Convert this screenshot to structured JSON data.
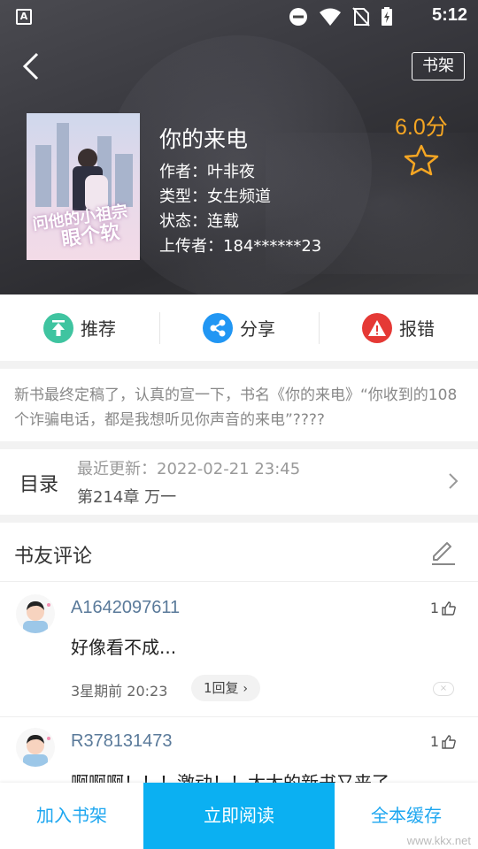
{
  "status_bar": {
    "time": "5:12",
    "app_icon_letter": "A"
  },
  "header": {
    "shelf_button": "书架",
    "title": "你的来电",
    "author": "作者：叶非夜",
    "genre": "类型：女生频道",
    "status": "状态：连载",
    "uploader": "上传者：184******23",
    "score": "6.0分",
    "cover_art_text": [
      "问他的小祖宗",
      "眼个软"
    ]
  },
  "actions": [
    {
      "label": "推荐",
      "icon": "recommend-icon",
      "color": "#3fc4a0"
    },
    {
      "label": "分享",
      "icon": "share-icon",
      "color": "#2196f3"
    },
    {
      "label": "报错",
      "icon": "report-error-icon",
      "color": "#e53935"
    }
  ],
  "description": "新书最终定稿了，认真的宣一下，书名《你的来电》“你收到的108个诈骗电话，都是我想听见你声音的来电”????",
  "toc": {
    "label": "目录",
    "latest_update": "最近更新：2022-02-21 23:45",
    "latest_chapter": "第214章 万一"
  },
  "comments": {
    "heading": "书友评论",
    "items": [
      {
        "user": "A1642097611",
        "likes": "1",
        "text": "好像看不成...",
        "time": "3星期前  20:23",
        "reply": "1回复"
      },
      {
        "user": "R378131473",
        "likes": "1",
        "text": "啊啊啊！！！激动！！太太的新书又来了"
      }
    ]
  },
  "bottom_bar": {
    "add_to_shelf": "加入书架",
    "read_now": "立即阅读",
    "cache_all": "全本缓存"
  },
  "watermark": "www.kkx.net",
  "accent_color": "#0bb0f2"
}
